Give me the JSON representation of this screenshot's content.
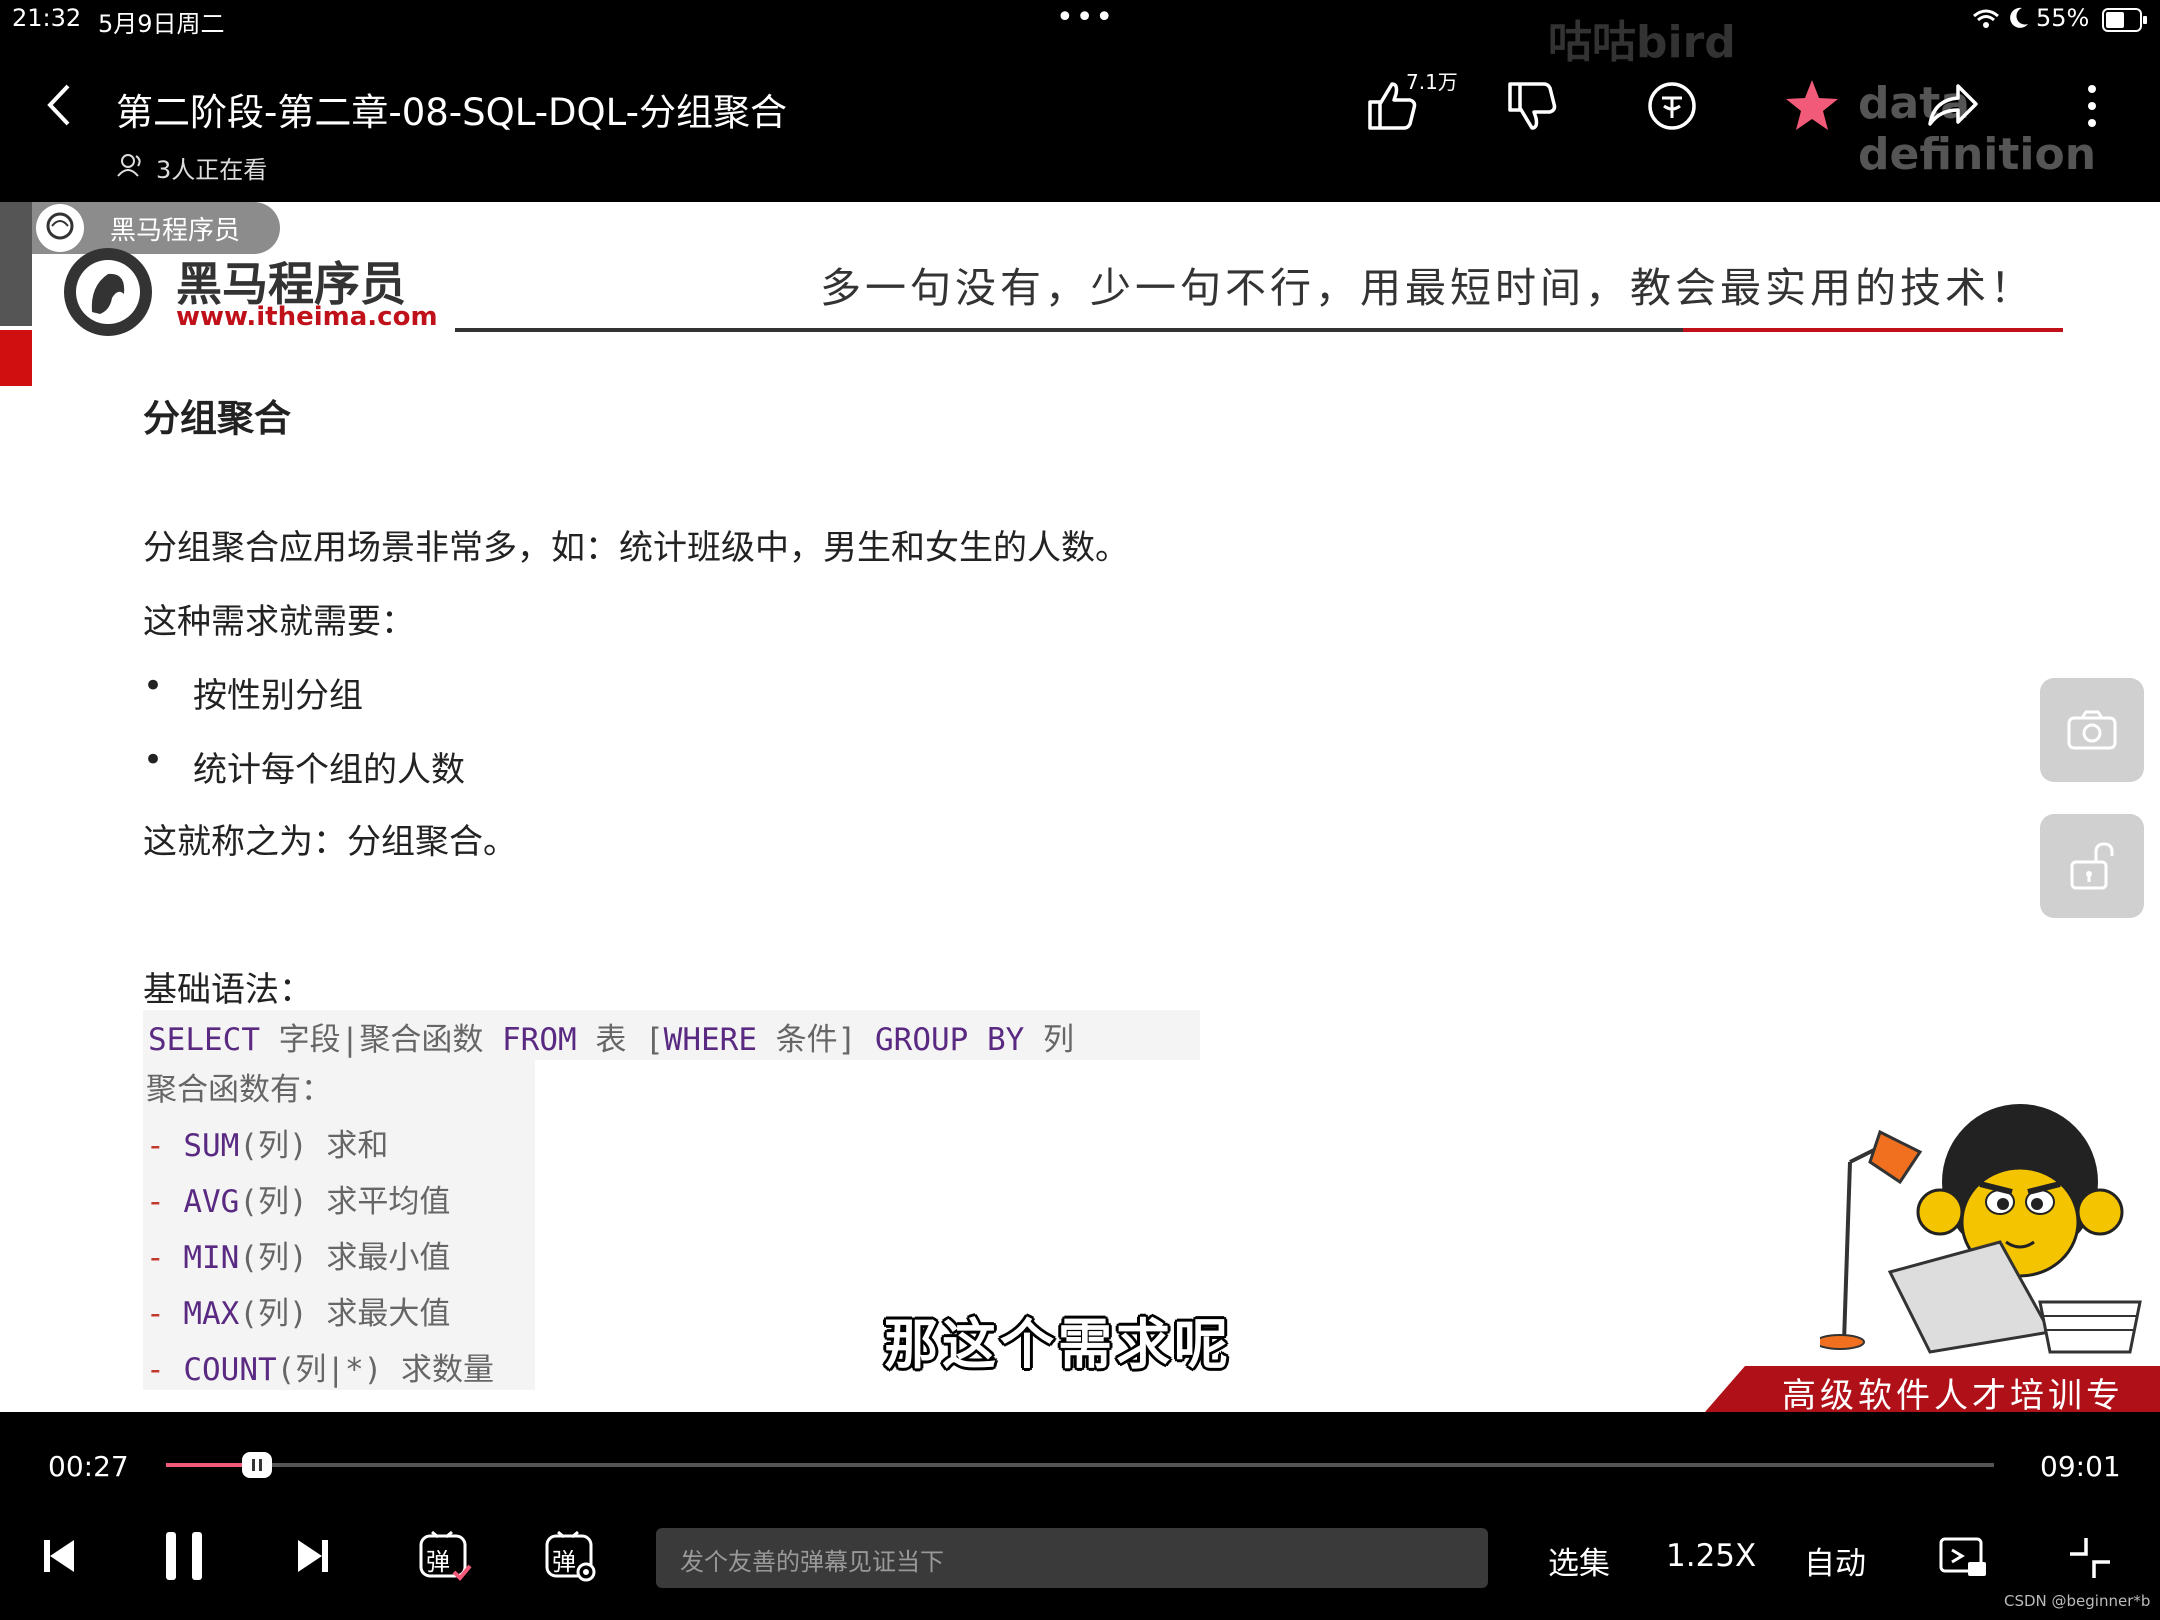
{
  "status": {
    "time": "21:32",
    "date": "5月9日周二",
    "battery": "55%",
    "watermark_top": "咕咕bird"
  },
  "header": {
    "title": "第二阶段-第二章-08-SQL-DQL-分组聚合",
    "viewers": "3人正在看",
    "like_count": "7.1万",
    "overlay_text": "data definition"
  },
  "slide": {
    "brand_badge": "黑马程序员",
    "logo_name": "黑马程序员",
    "logo_url": "www.itheima.com",
    "slogan": "多一句没有，少一句不行，用最短时间，教会最实用的技术！",
    "heading": "分组聚合",
    "para1": "分组聚合应用场景非常多，如：统计班级中，男生和女生的人数。",
    "para2": "这种需求就需要：",
    "bullets": [
      "按性别分组",
      "统计每个组的人数"
    ],
    "para3": "这就称之为：分组聚合。",
    "syntax_label": "基础语法：",
    "code": {
      "select": "SELECT",
      "fields": "字段|聚合函数",
      "from": "FROM",
      "table": "表",
      "lb": "[",
      "where": "WHERE",
      "cond": "条件]",
      "groupby": "GROUP BY",
      "col": "列",
      "agg_title": "聚合函数有：",
      "funcs": [
        {
          "name": "SUM",
          "arg": "(列)",
          "desc": "求和"
        },
        {
          "name": "AVG",
          "arg": "(列)",
          "desc": "求平均值"
        },
        {
          "name": "MIN",
          "arg": "(列)",
          "desc": "求最小值"
        },
        {
          "name": "MAX",
          "arg": "(列)",
          "desc": "求最大值"
        },
        {
          "name": "COUNT",
          "arg": "(列|*)",
          "desc": "求数量"
        }
      ]
    },
    "subtitle": "那这个需求呢",
    "banner": "高级软件人才培训专家"
  },
  "player": {
    "current_time": "00:27",
    "total_time": "09:01",
    "progress": 0.05,
    "danmu_placeholder": "发个友善的弹幕见证当下",
    "episodes": "选集",
    "speed": "1.25X",
    "quality": "自动",
    "danmu_label": "弹"
  },
  "footer_credit": "CSDN @beginner*b"
}
